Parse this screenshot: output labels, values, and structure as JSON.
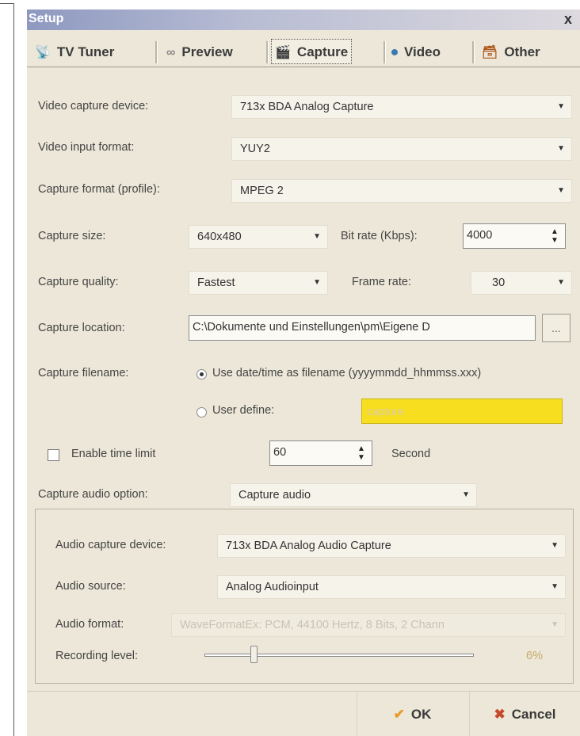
{
  "window": {
    "title": "Setup",
    "close_glyph": "x"
  },
  "tabs": [
    {
      "label": "TV Tuner",
      "icon": "satellite-dish-icon",
      "glyph": "📡"
    },
    {
      "label": "Preview",
      "icon": "binoculars-icon",
      "glyph": "∞"
    },
    {
      "label": "Capture",
      "icon": "film-capture-icon",
      "glyph": "🎬",
      "selected": true
    },
    {
      "label": "Video",
      "icon": "video-icon",
      "glyph": "⏺"
    },
    {
      "label": "Other",
      "icon": "toolbox-icon",
      "glyph": "🗃"
    }
  ],
  "form": {
    "video_capture_device": {
      "label": "Video capture device:",
      "value": "713x BDA Analog Capture"
    },
    "video_input_format": {
      "label": "Video input format:",
      "value": "YUY2"
    },
    "capture_format": {
      "label": "Capture format (profile):",
      "value": "MPEG 2"
    },
    "capture_size": {
      "label": "Capture size:",
      "value": "640x480"
    },
    "bit_rate": {
      "label": "Bit rate (Kbps):",
      "value": "4000"
    },
    "capture_quality": {
      "label": "Capture quality:",
      "value": "Fastest"
    },
    "frame_rate": {
      "label": "Frame rate:",
      "value": "30"
    },
    "capture_location": {
      "label": "Capture location:",
      "value": "C:\\Dokumente und Einstellungen\\pm\\Eigene D",
      "browse_label": "..."
    },
    "capture_filename": {
      "label": "Capture filename:",
      "option_datetime": "Use date/time as filename (yyyymmdd_hhmmss.xxx)",
      "option_user": "User define:",
      "user_value": "capture",
      "selected": "datetime"
    },
    "time_limit": {
      "label": "Enable time limit",
      "checked": false,
      "value": "60",
      "unit": "Second"
    },
    "capture_audio_option": {
      "label": "Capture audio option:",
      "value": "Capture audio"
    }
  },
  "audio": {
    "device": {
      "label": "Audio capture device:",
      "value": "713x BDA Analog Audio Capture"
    },
    "source": {
      "label": "Audio source:",
      "value": "Analog Audioinput"
    },
    "format": {
      "label": "Audio format:",
      "value": "WaveFormatEx: PCM, 44100 Hertz, 8 Bits, 2 Chann"
    },
    "recording_level": {
      "label": "Recording level:",
      "value_text": "6%",
      "level": 0.06
    }
  },
  "buttons": {
    "ok": "OK",
    "cancel": "Cancel"
  },
  "colors": {
    "highlight_field": "#f7de1f",
    "ok_check": "#e89a2a",
    "cancel_x": "#c64a2a"
  }
}
